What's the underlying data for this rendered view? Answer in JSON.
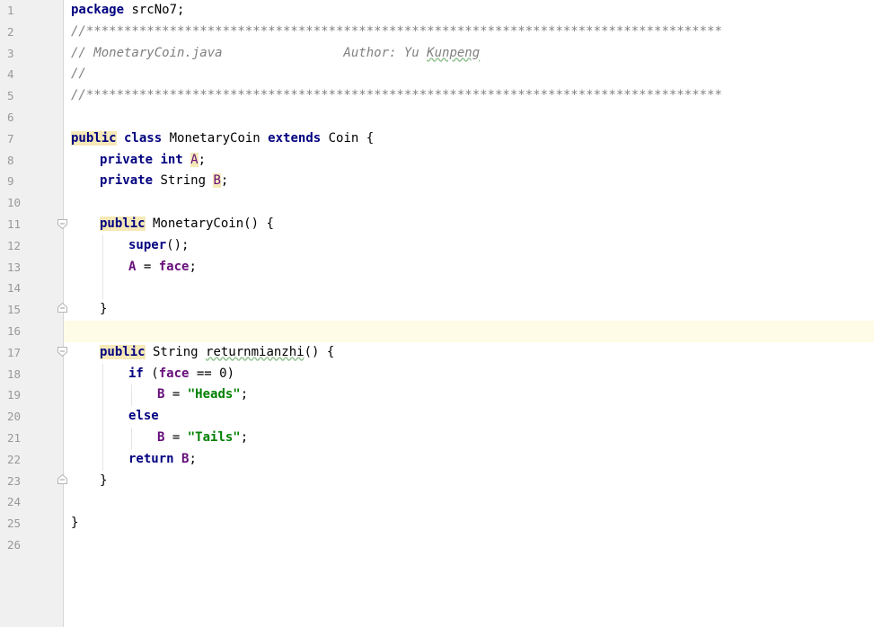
{
  "lines": [
    {
      "n": "1"
    },
    {
      "n": "2"
    },
    {
      "n": "3"
    },
    {
      "n": "4"
    },
    {
      "n": "5"
    },
    {
      "n": "6"
    },
    {
      "n": "7"
    },
    {
      "n": "8"
    },
    {
      "n": "9"
    },
    {
      "n": "10"
    },
    {
      "n": "11"
    },
    {
      "n": "12"
    },
    {
      "n": "13"
    },
    {
      "n": "14"
    },
    {
      "n": "15"
    },
    {
      "n": "16"
    },
    {
      "n": "17"
    },
    {
      "n": "18"
    },
    {
      "n": "19"
    },
    {
      "n": "20"
    },
    {
      "n": "21"
    },
    {
      "n": "22"
    },
    {
      "n": "23"
    },
    {
      "n": "24"
    },
    {
      "n": "25"
    },
    {
      "n": "26"
    }
  ],
  "code": {
    "l1": {
      "kw": "package",
      "rest": " srcNo7;"
    },
    "l2": "//************************************************************************************",
    "l3": {
      "a": "// MonetaryCoin.java                Author: Yu ",
      "b": "Kunpeng"
    },
    "l4": "//",
    "l5": "//************************************************************************************",
    "l7": {
      "kw1": "public",
      "kw2": " class",
      "t1": " MonetaryCoin ",
      "kw3": "extends",
      "t2": " Coin {"
    },
    "l8": {
      "kw1": "private",
      "kw2": " int",
      "sp": " ",
      "f": "A",
      "end": ";"
    },
    "l9": {
      "kw1": "private",
      "t1": " String ",
      "f": "B",
      "end": ";"
    },
    "l11": {
      "kw": "public",
      "t": " MonetaryCoin() {"
    },
    "l12": {
      "kw": "super",
      "t": "();"
    },
    "l13": {
      "f1": "A",
      "t": " = ",
      "f2": "face",
      "end": ";"
    },
    "l15": "}",
    "l17": {
      "kw": "public",
      "t1": " String ",
      "name": "returnmianzhi",
      "t2": "() {"
    },
    "l18": {
      "kw": "if",
      "t1": " (",
      "f": "face",
      "t2": " == 0)"
    },
    "l19": {
      "f": "B",
      "t": " = ",
      "s": "\"Heads\"",
      "end": ";"
    },
    "l20": {
      "kw": "else"
    },
    "l21": {
      "f": "B",
      "t": " = ",
      "s": "\"Tails\"",
      "end": ";"
    },
    "l22": {
      "kw": "return",
      "sp": " ",
      "f": "B",
      "end": ";"
    },
    "l23": "}",
    "l25": "}"
  },
  "colors": {
    "keyword": "#000080",
    "comment": "#808080",
    "field": "#660e7a",
    "string": "#008000",
    "current_line": "#fefbe6"
  }
}
